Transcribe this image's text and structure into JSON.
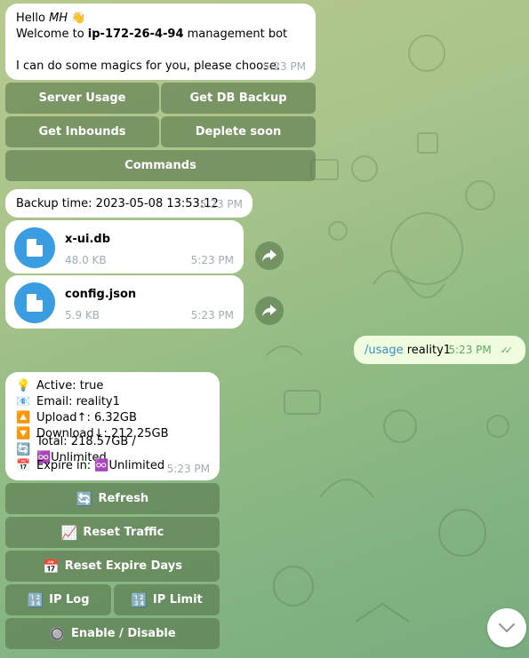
{
  "greeting": {
    "hello_prefix": "Hello ",
    "hello_name": "MH",
    "wave_emoji": "👋",
    "welcome_prefix": "Welcome to ",
    "host": "ip-172-26-4-94",
    "welcome_suffix": " management bot",
    "prompt": "I can do some magics for you, please choose:",
    "time": "5:23 PM"
  },
  "main_keyboard": {
    "server_usage": "Server Usage",
    "get_db_backup": "Get DB Backup",
    "get_inbounds": "Get Inbounds",
    "deplete_soon": "Deplete soon",
    "commands": "Commands"
  },
  "backup": {
    "text": "Backup time: 2023-05-08 13:53:12",
    "time": "5:23 PM"
  },
  "files": [
    {
      "name": "x-ui.db",
      "size": "48.0 KB",
      "time": "5:23 PM"
    },
    {
      "name": "config.json",
      "size": "5.9 KB",
      "time": "5:23 PM"
    }
  ],
  "outgoing": {
    "command": "/usage",
    "arg": " reality1",
    "time": "5:23 PM",
    "check": "✓✓"
  },
  "usage": {
    "lines": [
      {
        "icon": "💡",
        "text": "Active: true"
      },
      {
        "icon": "📧",
        "text": "Email: reality1"
      },
      {
        "icon": "🔼",
        "text": "Upload↑: 6.32GB"
      },
      {
        "icon": "🔽",
        "text": "Download↓: 212.25GB"
      },
      {
        "icon": "🔄",
        "text": "Total: 218.57GB / ♾️Unlimited"
      },
      {
        "icon": "📅",
        "text": "Expire in: ♾️Unlimited"
      }
    ],
    "time": "5:23 PM"
  },
  "usage_keyboard": {
    "refresh": {
      "icon": "🔄",
      "label": "Refresh"
    },
    "reset_traffic": {
      "icon": "📈",
      "label": "Reset Traffic"
    },
    "reset_expire": {
      "icon": "📅",
      "label": "Reset Expire Days"
    },
    "ip_log": {
      "icon": "🔢",
      "label": "IP Log"
    },
    "ip_limit": {
      "icon": "🔢",
      "label": "IP Limit"
    },
    "enable_disable": {
      "icon": "🔘",
      "label": "Enable / Disable"
    }
  },
  "colors": {
    "accent": "#3a9de1",
    "link": "#3a8fc4",
    "outgoing_bg": "#effdde",
    "outgoing_time": "#5fa865"
  }
}
